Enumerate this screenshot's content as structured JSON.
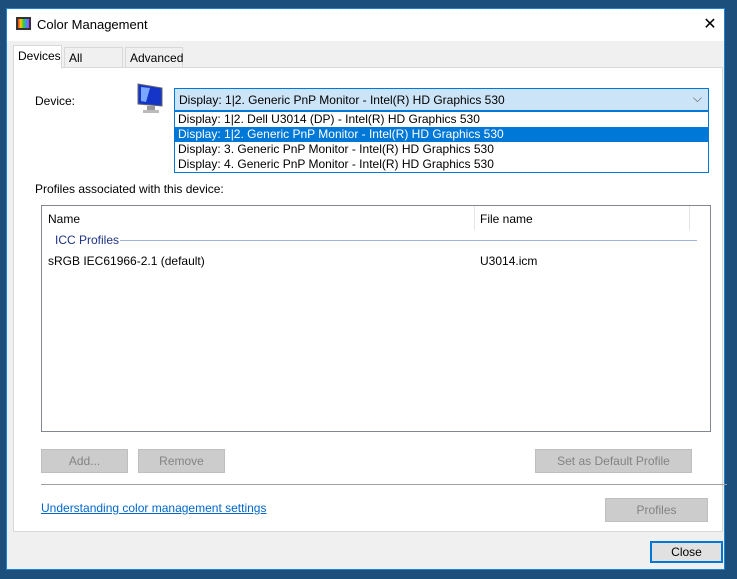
{
  "window": {
    "title": "Color Management"
  },
  "tabs": [
    {
      "label": "Devices"
    },
    {
      "label": "All Profiles"
    },
    {
      "label": "Advanced"
    }
  ],
  "device": {
    "label": "Device:",
    "selected": "Display: 1|2. Generic PnP Monitor - Intel(R) HD Graphics 530",
    "options": [
      "Display: 1|2. Dell U3014 (DP) - Intel(R) HD Graphics 530",
      "Display: 1|2. Generic PnP Monitor - Intel(R) HD Graphics 530",
      "Display: 3. Generic PnP Monitor - Intel(R) HD Graphics 530",
      "Display: 4. Generic PnP Monitor - Intel(R) HD Graphics 530"
    ]
  },
  "profiles": {
    "label": "Profiles associated with this device:",
    "columns": [
      "Name",
      "File name"
    ],
    "group": "ICC Profiles",
    "rows": [
      {
        "name": "sRGB IEC61966-2.1 (default)",
        "file": "U3014.icm"
      }
    ]
  },
  "buttons": {
    "add": "Add...",
    "remove": "Remove",
    "set_default": "Set as Default Profile",
    "profiles": "Profiles",
    "close": "Close"
  },
  "link": "Understanding color management settings"
}
